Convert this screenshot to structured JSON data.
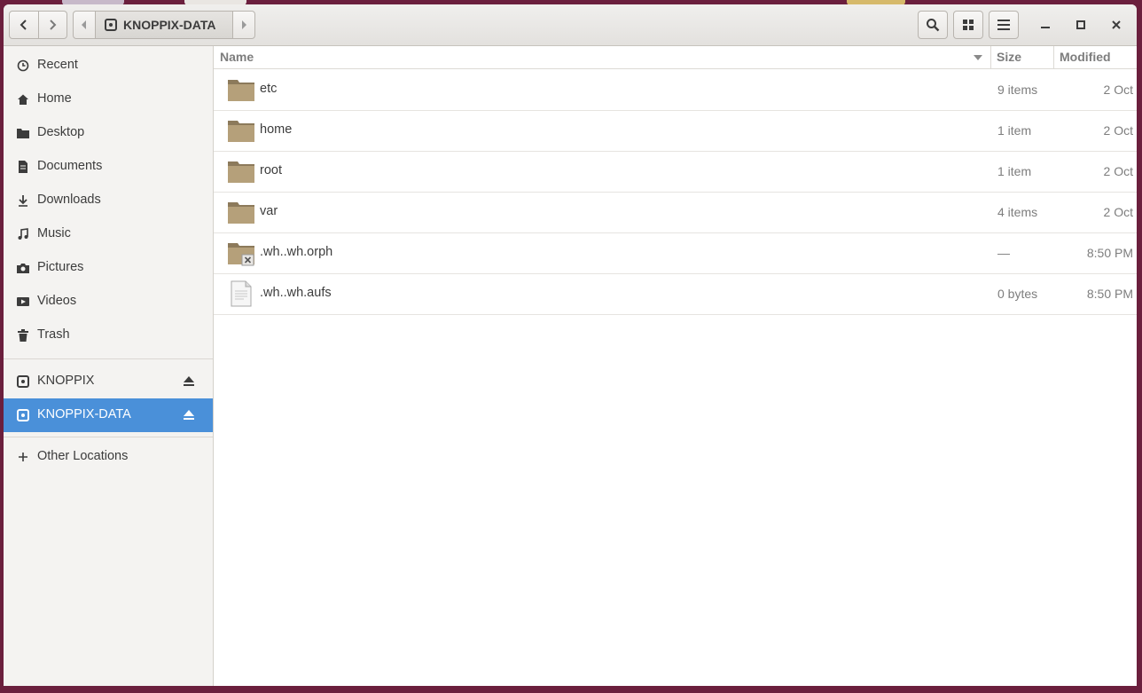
{
  "window": {
    "path_button": "KNOPPIX-DATA"
  },
  "sidebar": {
    "places": [
      {
        "label": "Recent",
        "icon": "clock-icon"
      },
      {
        "label": "Home",
        "icon": "home-icon"
      },
      {
        "label": "Desktop",
        "icon": "folder-icon"
      },
      {
        "label": "Documents",
        "icon": "document-icon"
      },
      {
        "label": "Downloads",
        "icon": "download-icon"
      },
      {
        "label": "Music",
        "icon": "music-icon"
      },
      {
        "label": "Pictures",
        "icon": "camera-icon"
      },
      {
        "label": "Videos",
        "icon": "video-icon"
      },
      {
        "label": "Trash",
        "icon": "trash-icon"
      }
    ],
    "devices": [
      {
        "label": "KNOPPIX",
        "icon": "drive-icon",
        "selected": false
      },
      {
        "label": "KNOPPIX-DATA",
        "icon": "drive-icon",
        "selected": true
      }
    ],
    "other_locations": "Other Locations"
  },
  "columns": {
    "name": "Name",
    "size": "Size",
    "modified": "Modified"
  },
  "files": [
    {
      "name": "etc",
      "size": "9 items",
      "modified": "2 Oct",
      "type": "folder"
    },
    {
      "name": "home",
      "size": "1 item",
      "modified": "2 Oct",
      "type": "folder"
    },
    {
      "name": "root",
      "size": "1 item",
      "modified": "2 Oct",
      "type": "folder"
    },
    {
      "name": "var",
      "size": "4 items",
      "modified": "2 Oct",
      "type": "folder"
    },
    {
      "name": ".wh..wh.orph",
      "size": "—",
      "modified": "8:50 PM",
      "type": "folder-locked"
    },
    {
      "name": ".wh..wh.aufs",
      "size": "0 bytes",
      "modified": "8:50 PM",
      "type": "file"
    }
  ],
  "colors": {
    "selection": "#4a90d9",
    "folder": "#b5a07a",
    "desktop": "#6b1f3d"
  }
}
